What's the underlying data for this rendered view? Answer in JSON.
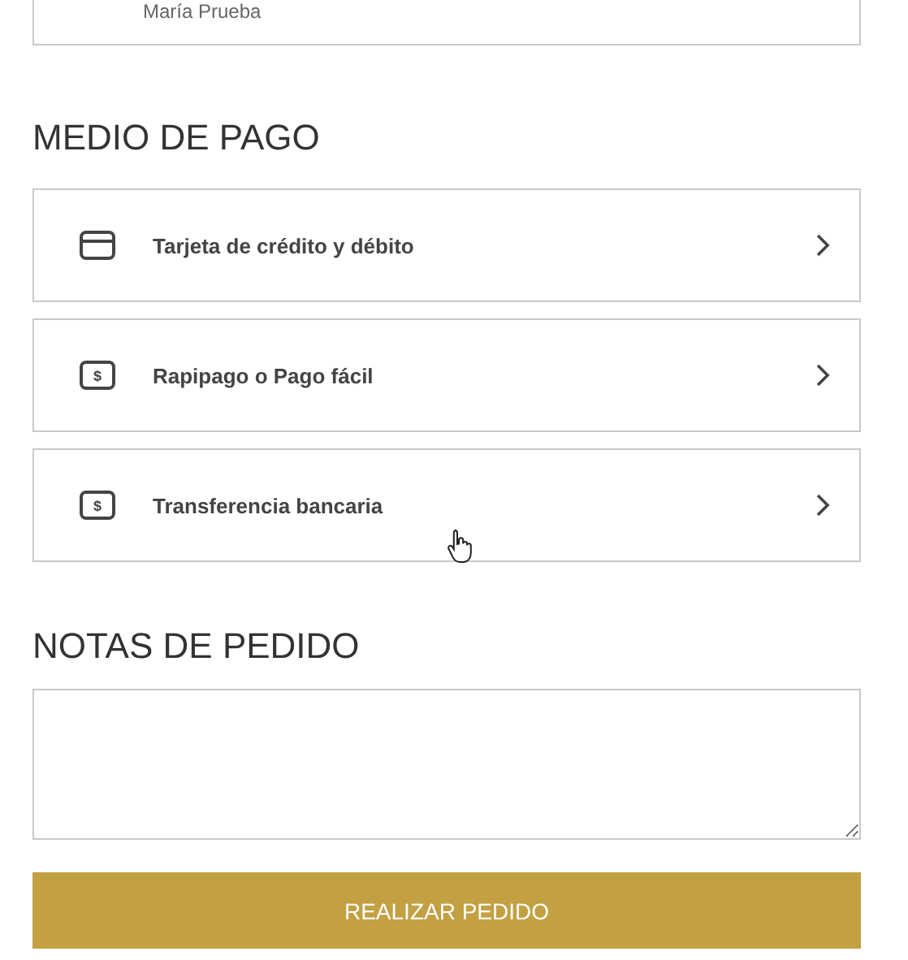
{
  "customer_card": {
    "name": "María Prueba"
  },
  "payment": {
    "title": "MEDIO DE PAGO",
    "options": [
      {
        "kind": "card",
        "label": "Tarjeta de crédito y débito",
        "hovered": false
      },
      {
        "kind": "cash",
        "symbol": "$",
        "label": "Rapipago o Pago fácil",
        "hovered": false
      },
      {
        "kind": "cash",
        "symbol": "$",
        "label": "Transferencia bancaria",
        "hovered": true
      }
    ]
  },
  "notes": {
    "title": "NOTAS DE PEDIDO"
  },
  "submit": {
    "label": "REALIZAR PEDIDO"
  }
}
